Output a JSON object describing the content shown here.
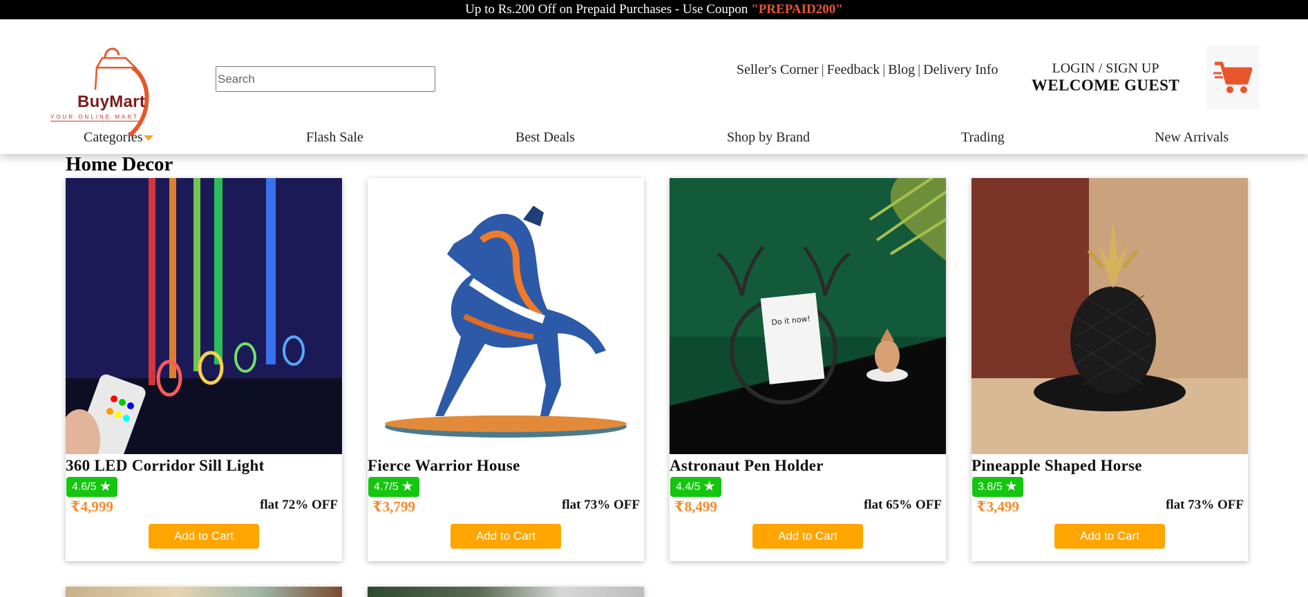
{
  "promo": {
    "text": "Up to Rs.200 Off on Prepaid Purchases - Use Coupon ",
    "code": "\"PREPAID200\"",
    "code_color": "#e8562b"
  },
  "logo": {
    "brand": "BuyMart",
    "tagline": "YOUR ONLINE MART",
    "icon": "shopping-bag-logo"
  },
  "search": {
    "placeholder": "Search",
    "value": ""
  },
  "top_links": [
    "Seller's Corner",
    "Feedback",
    "Blog",
    "Delivery Info"
  ],
  "account": {
    "login": "LOGIN / SIGN UP",
    "welcome": "WELCOME GUEST"
  },
  "cart": {
    "icon": "shopping-cart-icon",
    "color": "#e8562b"
  },
  "nav": [
    "Categories",
    "Flash Sale",
    "Best Deals",
    "Shop by Brand",
    "Trading",
    "New Arrivals"
  ],
  "section": {
    "title": "Home Decor"
  },
  "products": [
    {
      "name": "360 LED Corridor Sill Light",
      "rating": "4.6/5",
      "price": "₹4,999",
      "discount": "flat 72% OFF",
      "button": "Add to Cart"
    },
    {
      "name": "Fierce Warrior House",
      "rating": "4.7/5",
      "price": "₹3,799",
      "discount": "flat 73% OFF",
      "button": "Add to Cart"
    },
    {
      "name": "Astronaut Pen Holder",
      "rating": "4.4/5",
      "price": "₹8,499",
      "discount": "flat 65% OFF",
      "button": "Add to Cart"
    },
    {
      "name": "Pineapple Shaped Horse",
      "rating": "3.8/5",
      "price": "₹3,499",
      "discount": "flat 73% OFF",
      "button": "Add to Cart"
    }
  ],
  "colors": {
    "accent": "#ffa500",
    "rating_badge": "#14c60f",
    "price": "#f78a2d",
    "brand": "#7a1c1c"
  }
}
